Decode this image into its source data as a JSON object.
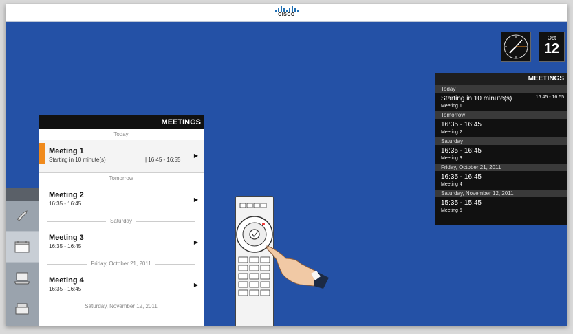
{
  "brand": {
    "logo_text": "CISCO"
  },
  "date_tile": {
    "month": "Oct",
    "day": "12"
  },
  "left_panel": {
    "title": "MEETINGS",
    "sections": [
      {
        "label": "Today",
        "items": [
          {
            "name": "Meeting 1",
            "sub": "Starting in 10 minute(s)",
            "right": "| 16:45 - 16:55",
            "selected": true
          }
        ]
      },
      {
        "label": "Tomorrow",
        "items": [
          {
            "name": "Meeting 2",
            "sub": "16:35 - 16:45"
          }
        ]
      },
      {
        "label": "Saturday",
        "items": [
          {
            "name": "Meeting 3",
            "sub": "16:35 - 16:45"
          }
        ]
      },
      {
        "label": "Friday, October 21, 2011",
        "items": [
          {
            "name": "Meeting 4",
            "sub": "16:35 - 16:45"
          }
        ]
      },
      {
        "label": "Saturday, November 12, 2011",
        "items": []
      }
    ]
  },
  "right_panel": {
    "title": "MEETINGS",
    "sections": [
      {
        "label": "Today",
        "time": "Starting in 10 minute(s)",
        "name": "Meeting 1",
        "right": "16:45 - 16:55"
      },
      {
        "label": "Tomorrow",
        "time": "16:35 - 16:45",
        "name": "Meeting 2"
      },
      {
        "label": "Saturday",
        "time": "16:35 - 16:45",
        "name": "Meeting 3"
      },
      {
        "label": "Friday, October 21, 2011",
        "time": "16:35 - 16:45",
        "name": "Meeting 4"
      },
      {
        "label": "Saturday, November 12, 2011",
        "time": "15:35 - 15:45",
        "name": "Meeting 5"
      }
    ]
  },
  "icons": {
    "logo": "cisco-logo",
    "clock": "analog-clock-icon",
    "dock": [
      "handset-icon",
      "calendar-icon",
      "laptop-icon",
      "desk-phone-icon"
    ],
    "remote": "remote-control",
    "hand": "pointing-hand"
  },
  "colors": {
    "background": "#2451a6",
    "accent": "#f08a1c"
  }
}
